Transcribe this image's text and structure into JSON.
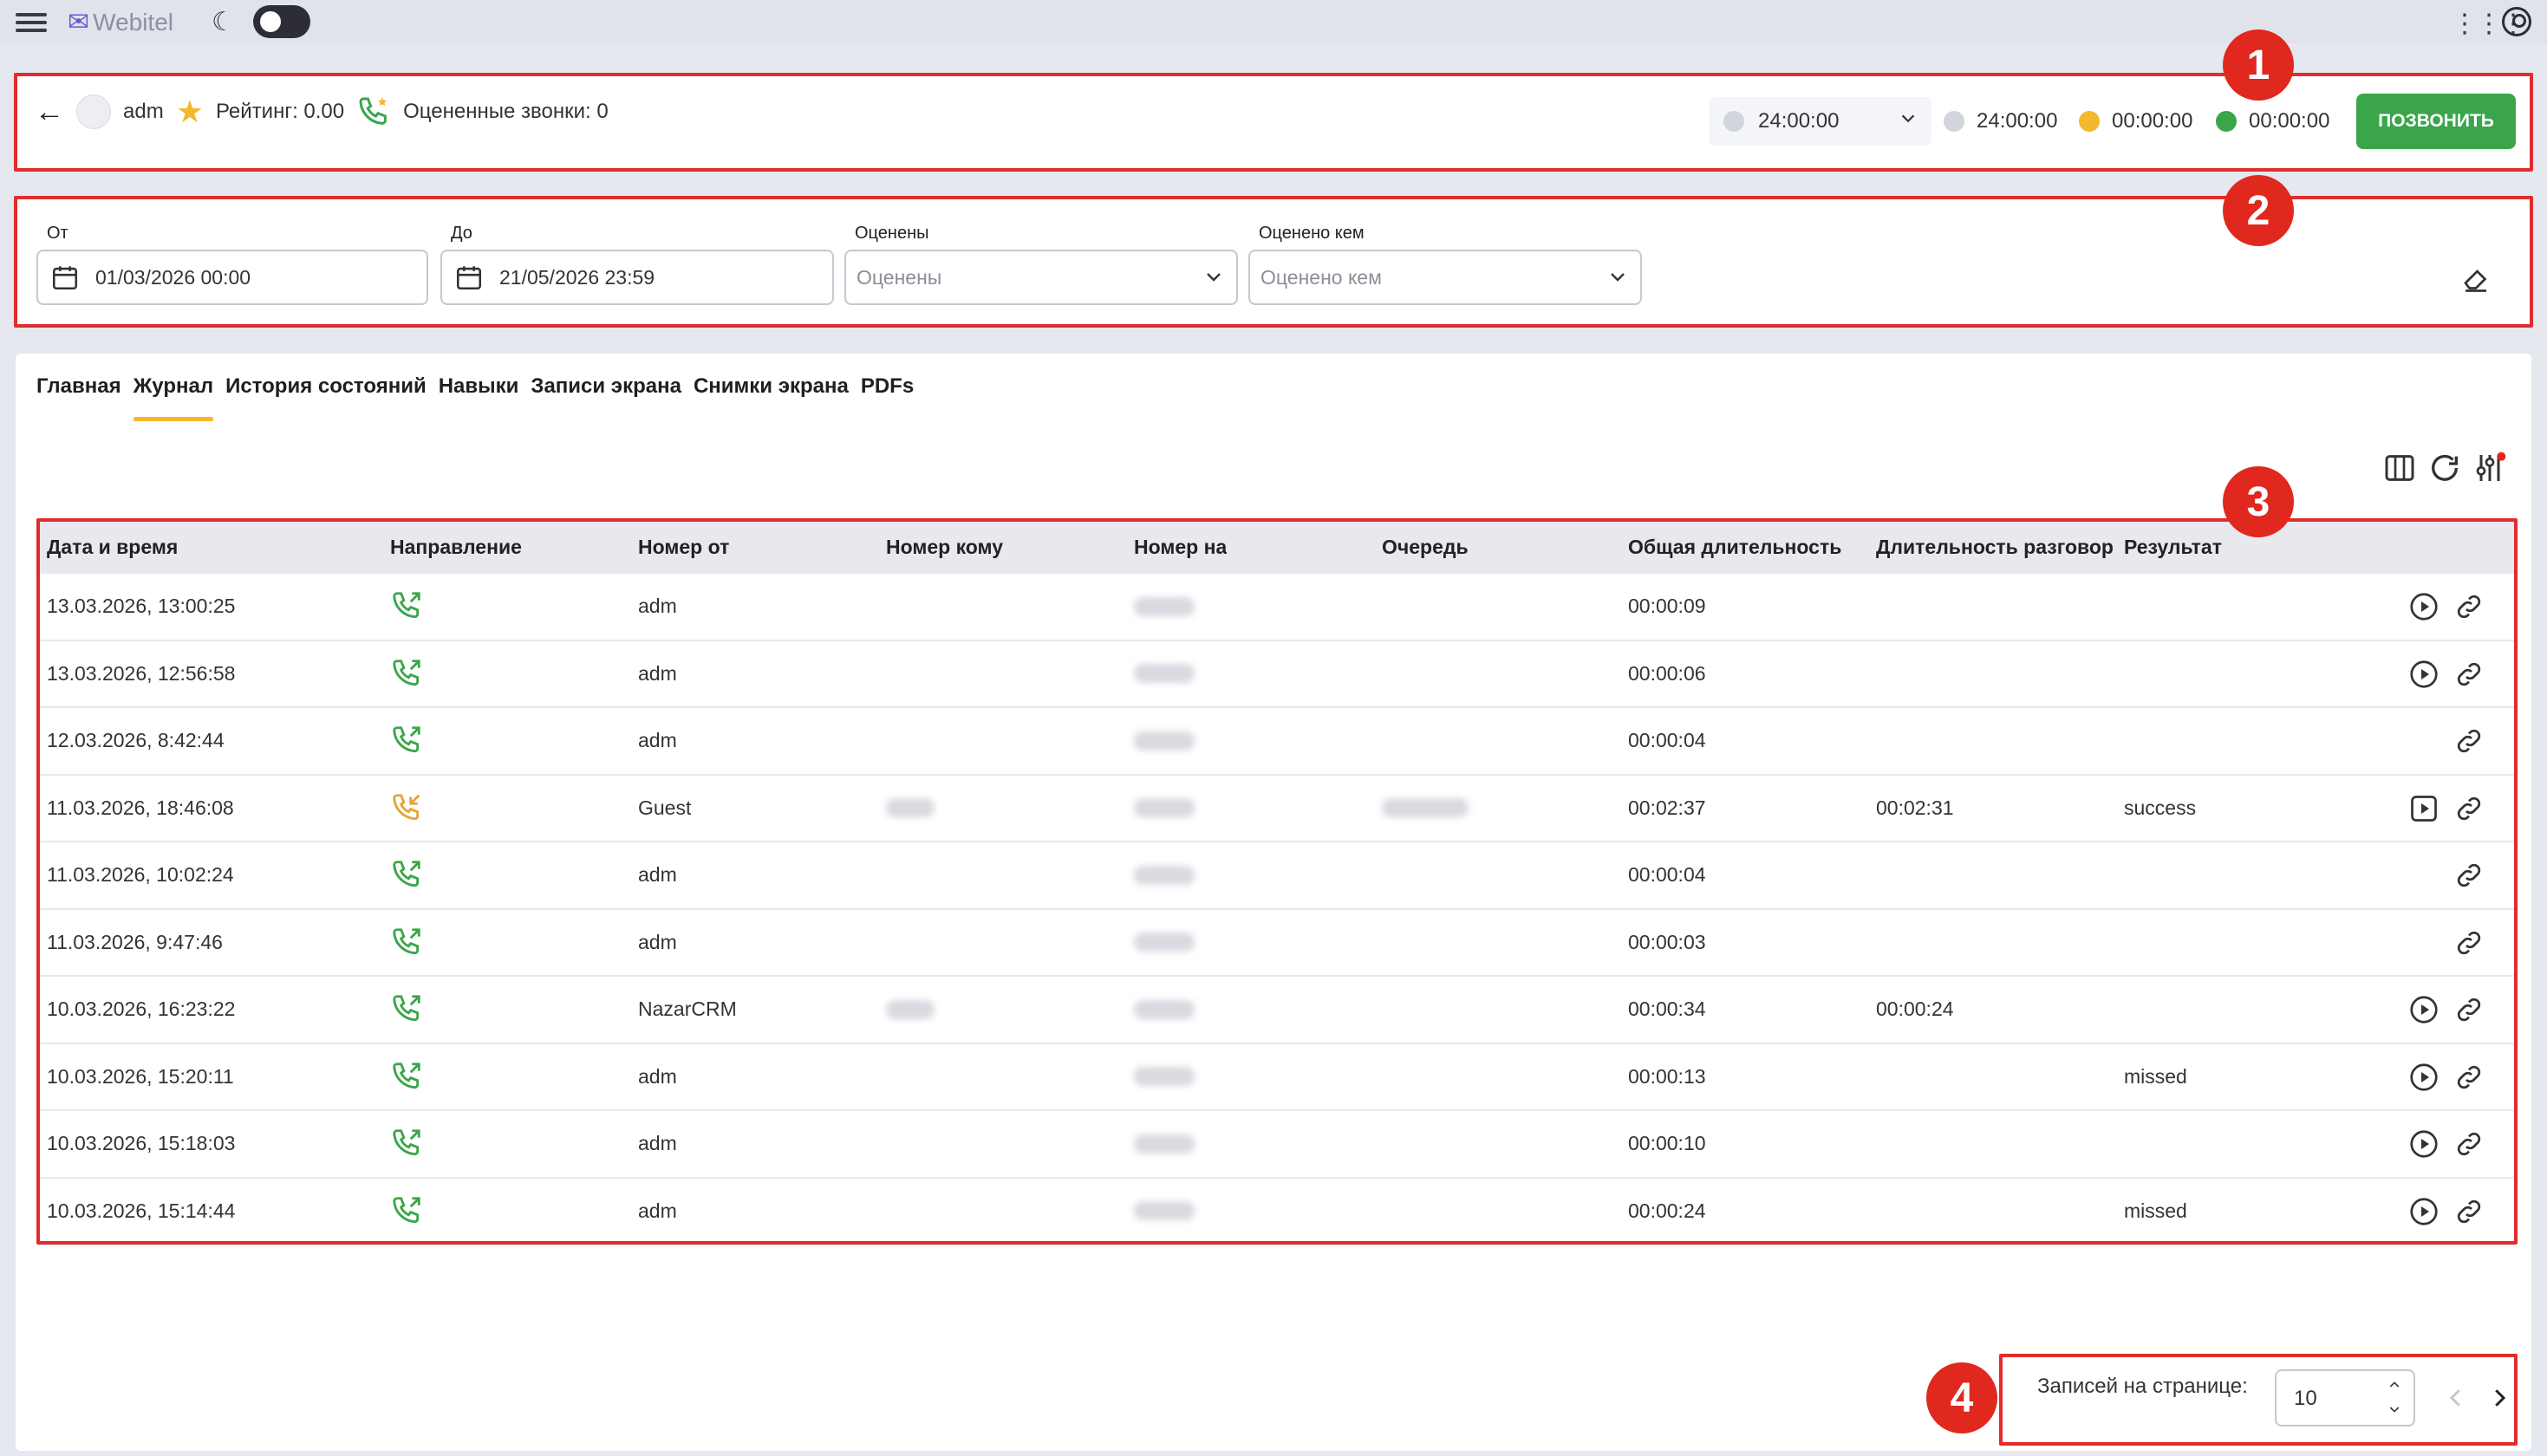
{
  "app": {
    "name": "Webitel"
  },
  "agent": {
    "name": "adm",
    "rating_label": "Рейтинг: 0.00",
    "rated_calls_label": "Оцененные звонки: 0"
  },
  "status": {
    "selected_time": "24:00:00",
    "timers": [
      {
        "value": "24:00:00",
        "color": "#d3d5dd"
      },
      {
        "value": "00:00:00",
        "color": "#f4b82e"
      },
      {
        "value": "00:00:00",
        "color": "#3aa54a"
      }
    ],
    "call_button": "ПОЗВОНИТЬ"
  },
  "filters": {
    "from": {
      "label": "От",
      "value": "01/03/2026 00:00"
    },
    "to": {
      "label": "До",
      "value": "21/05/2026 23:59"
    },
    "rated": {
      "label": "Оценены",
      "placeholder": "Оценены"
    },
    "rated_by": {
      "label": "Оценено кем",
      "placeholder": "Оценено кем"
    }
  },
  "tabs": [
    {
      "label": "Главная"
    },
    {
      "label": "Журнал",
      "active": true
    },
    {
      "label": "История состояний"
    },
    {
      "label": "Навыки"
    },
    {
      "label": "Записи экрана"
    },
    {
      "label": "Снимки экрана"
    },
    {
      "label": "PDFs"
    }
  ],
  "table": {
    "columns": [
      "Дата и время",
      "Направление",
      "Номер от",
      "Номер кому",
      "Номер на",
      "Очередь",
      "Общая длительность",
      "Длительность разговора",
      "Результат"
    ],
    "rows": [
      {
        "datetime": "13.03.2026, 13:00:25",
        "direction": "outbound",
        "from": "adm",
        "to": "",
        "on": "blurred",
        "queue": "",
        "total": "00:00:09",
        "talk": "",
        "result": "",
        "actions": [
          "play-icon",
          "link-icon"
        ]
      },
      {
        "datetime": "13.03.2026, 12:56:58",
        "direction": "outbound",
        "from": "adm",
        "to": "",
        "on": "blurred",
        "queue": "",
        "total": "00:00:06",
        "talk": "",
        "result": "",
        "actions": [
          "play-icon",
          "link-icon"
        ]
      },
      {
        "datetime": "12.03.2026, 8:42:44",
        "direction": "outbound",
        "from": "adm",
        "to": "",
        "on": "blurred",
        "queue": "",
        "total": "00:00:04",
        "talk": "",
        "result": "",
        "actions": [
          "link-icon"
        ]
      },
      {
        "datetime": "11.03.2026, 18:46:08",
        "direction": "inbound",
        "from": "Guest",
        "to": "blurred",
        "on": "blurred",
        "queue": "blurred",
        "total": "00:02:37",
        "talk": "00:02:31",
        "result": "success",
        "actions": [
          "video-icon",
          "link-icon"
        ]
      },
      {
        "datetime": "11.03.2026, 10:02:24",
        "direction": "outbound",
        "from": "adm",
        "to": "",
        "on": "blurred",
        "queue": "",
        "total": "00:00:04",
        "talk": "",
        "result": "",
        "actions": [
          "link-icon"
        ]
      },
      {
        "datetime": "11.03.2026, 9:47:46",
        "direction": "outbound",
        "from": "adm",
        "to": "",
        "on": "blurred",
        "queue": "",
        "total": "00:00:03",
        "talk": "",
        "result": "",
        "actions": [
          "link-icon"
        ]
      },
      {
        "datetime": "10.03.2026, 16:23:22",
        "direction": "outbound",
        "from": "NazarCRM",
        "to": "blurred",
        "on": "blurred",
        "queue": "",
        "total": "00:00:34",
        "talk": "00:00:24",
        "result": "",
        "actions": [
          "play-icon",
          "link-icon"
        ]
      },
      {
        "datetime": "10.03.2026, 15:20:11",
        "direction": "outbound",
        "from": "adm",
        "to": "",
        "on": "blurred",
        "queue": "",
        "total": "00:00:13",
        "talk": "",
        "result": "missed",
        "actions": [
          "play-icon",
          "link-icon"
        ]
      },
      {
        "datetime": "10.03.2026, 15:18:03",
        "direction": "outbound",
        "from": "adm",
        "to": "",
        "on": "blurred",
        "queue": "",
        "total": "00:00:10",
        "talk": "",
        "result": "",
        "actions": [
          "play-icon",
          "link-icon"
        ]
      },
      {
        "datetime": "10.03.2026, 15:14:44",
        "direction": "outbound",
        "from": "adm",
        "to": "",
        "on": "blurred",
        "queue": "",
        "total": "00:00:24",
        "talk": "",
        "result": "missed",
        "actions": [
          "play-icon",
          "link-icon"
        ]
      }
    ]
  },
  "pagination": {
    "label": "Записей на странице:",
    "per_page": "10"
  },
  "annotations": [
    "1",
    "2",
    "3",
    "4"
  ],
  "colors": {
    "accent": "#f4b82e",
    "call_green": "#3aa54a",
    "annotation_red": "#e02d2d",
    "outbound_icon": "#3aa54a",
    "inbound_icon": "#e6a33a"
  }
}
